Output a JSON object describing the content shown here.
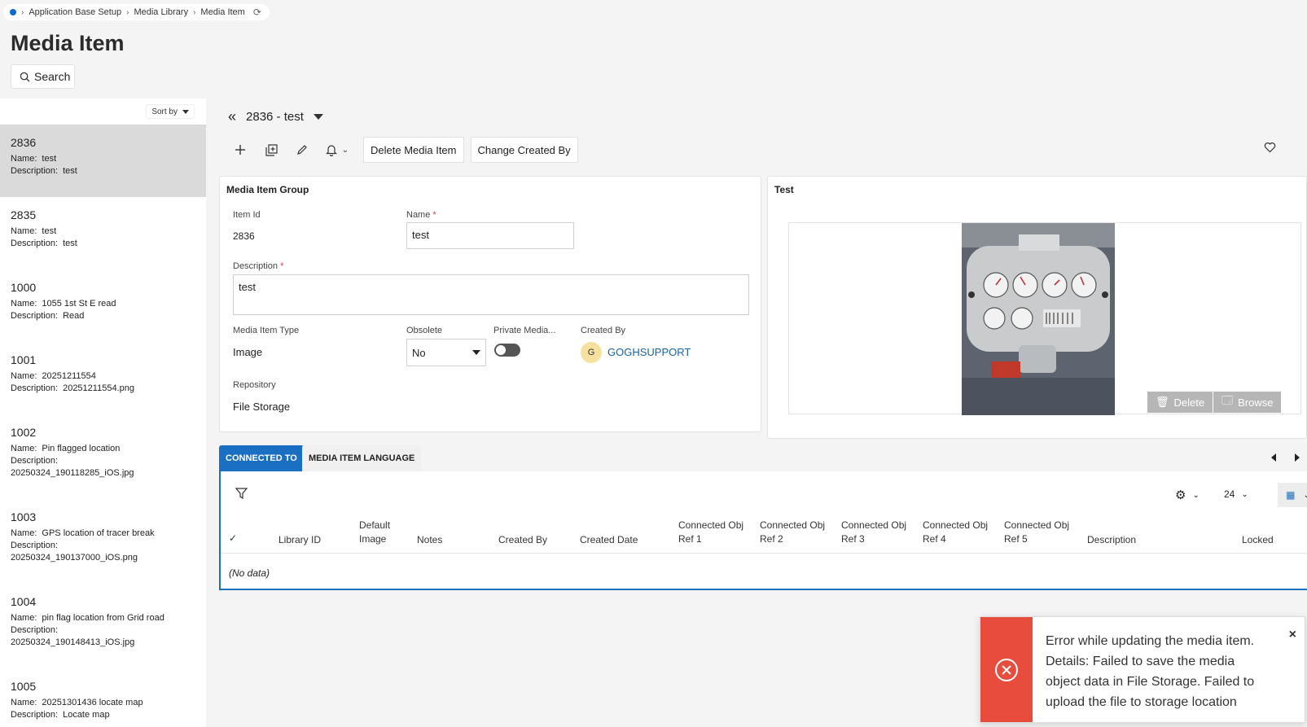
{
  "breadcrumb": {
    "items": [
      "Application Base Setup",
      "Media Library",
      "Media Item"
    ]
  },
  "page": {
    "title": "Media Item",
    "search_label": "Search"
  },
  "list": {
    "sort_label": "Sort by",
    "name_key": "Name:",
    "desc_key": "Description:",
    "items": [
      {
        "id": "2836",
        "name": "test",
        "description": "test"
      },
      {
        "id": "2835",
        "name": "test",
        "description": "test"
      },
      {
        "id": "1000",
        "name": "1055 1st St E read",
        "description": "Read"
      },
      {
        "id": "1001",
        "name": "20251211554",
        "description": "20251211554.png"
      },
      {
        "id": "1002",
        "name": "Pin flagged location",
        "description": "20250324_190118285_iOS.jpg"
      },
      {
        "id": "1003",
        "name": "GPS location of tracer break",
        "description": "20250324_190137000_iOS.png"
      },
      {
        "id": "1004",
        "name": "pin flag location from Grid road",
        "description": "20250324_190148413_iOS.jpg"
      },
      {
        "id": "1005",
        "name": "20251301436 locate map",
        "description": "Locate map"
      }
    ]
  },
  "record": {
    "title": "2836 - test",
    "buttons": {
      "delete": "Delete Media Item",
      "change_created_by": "Change Created By"
    }
  },
  "group": {
    "title": "Media Item Group",
    "item_id_label": "Item Id",
    "item_id": "2836",
    "name_label": "Name",
    "name_value": "test",
    "description_label": "Description",
    "description_value": "test",
    "type_label": "Media Item Type",
    "type_value": "Image",
    "obsolete_label": "Obsolete",
    "obsolete_value": "No",
    "private_label": "Private Media...",
    "created_by_label": "Created By",
    "created_by_initial": "G",
    "created_by_value": "GOGHSUPPORT",
    "repository_label": "Repository",
    "repository_value": "File Storage",
    "required_mark": "*"
  },
  "image_panel": {
    "title": "Test",
    "delete_label": "Delete",
    "browse_label": "Browse"
  },
  "tabs": {
    "connected_to": "CONNECTED TO",
    "language": "MEDIA ITEM LANGUAGE"
  },
  "grid": {
    "page_size": "24",
    "columns": [
      "Library ID",
      "Default Image",
      "Notes",
      "Created By",
      "Created Date",
      "Connected Obj Ref 1",
      "Connected Obj Ref 2",
      "Connected Obj Ref 3",
      "Connected Obj Ref 4",
      "Connected Obj Ref 5",
      "Description",
      "Locked"
    ],
    "no_data": "(No data)"
  },
  "toast": {
    "message": "Error while updating the media item. Details: Failed to save the media object data in File Storage. Failed to upload the file to storage location",
    "close": "×"
  },
  "colors": {
    "accent": "#1a6fc2",
    "error": "#e74c3c",
    "link": "#1563a8"
  }
}
